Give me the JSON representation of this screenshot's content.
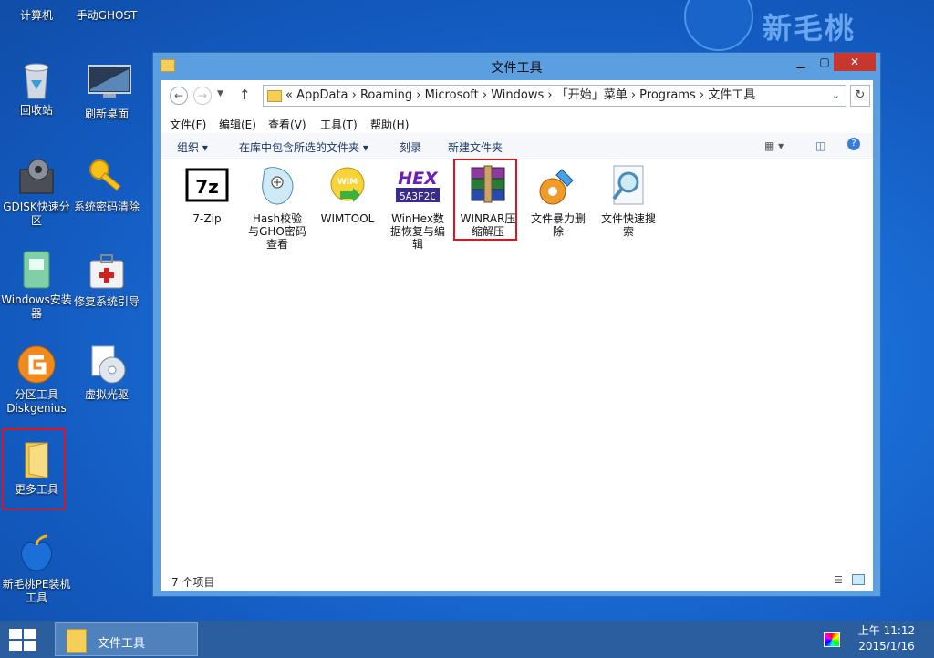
{
  "logo": {
    "text": "新毛桃"
  },
  "desktop_icons": [
    {
      "label": "计算机",
      "icon": "computer-icon"
    },
    {
      "label": "手动GHOST",
      "icon": "ghost-icon"
    },
    {
      "label": "回收站",
      "icon": "recycle-bin-icon"
    },
    {
      "label": "刷新桌面",
      "icon": "monitor-icon"
    },
    {
      "label": "GDISK快速分区",
      "icon": "gdisk-icon"
    },
    {
      "label": "系统密码清除",
      "icon": "key-icon"
    },
    {
      "label": "Windows安装器",
      "icon": "windows-installer-icon"
    },
    {
      "label": "修复系统引导",
      "icon": "repair-kit-icon"
    },
    {
      "label": "分区工具Diskgenius",
      "icon": "diskgenius-icon"
    },
    {
      "label": "虚拟光驱",
      "icon": "virtual-drive-icon"
    },
    {
      "label": "更多工具",
      "icon": "folder-icon"
    },
    {
      "label": "新毛桃PE装机工具",
      "icon": "peach-icon"
    }
  ],
  "window": {
    "title": "文件工具",
    "address_path": "«  AppData  ›  Roaming  ›  Microsoft  ›  Windows  ›  「开始」菜单  ›  Programs  ›  文件工具",
    "menu": [
      "文件(F)",
      "编辑(E)",
      "查看(V)",
      "工具(T)",
      "帮助(H)"
    ],
    "toolbar": [
      "组织 ▾",
      "在库中包含所选的文件夹 ▾",
      "刻录",
      "新建文件夹"
    ],
    "files": [
      {
        "label": "7-Zip",
        "icon": "7zip-icon"
      },
      {
        "label": "Hash校验与GHO密码查看",
        "icon": "hash-icon"
      },
      {
        "label": "WIMTOOL",
        "icon": "wimtool-icon"
      },
      {
        "label": "WinHex数据恢复与编辑",
        "icon": "winhex-icon"
      },
      {
        "label": "WINRAR压缩解压",
        "icon": "winrar-icon"
      },
      {
        "label": "文件暴力删除",
        "icon": "file-delete-icon"
      },
      {
        "label": "文件快速搜索",
        "icon": "file-search-icon"
      }
    ],
    "status": "7 个项目"
  },
  "taskbar": {
    "item_label": "文件工具",
    "clock_time": "上午 11:12",
    "clock_date": "2015/1/16"
  }
}
